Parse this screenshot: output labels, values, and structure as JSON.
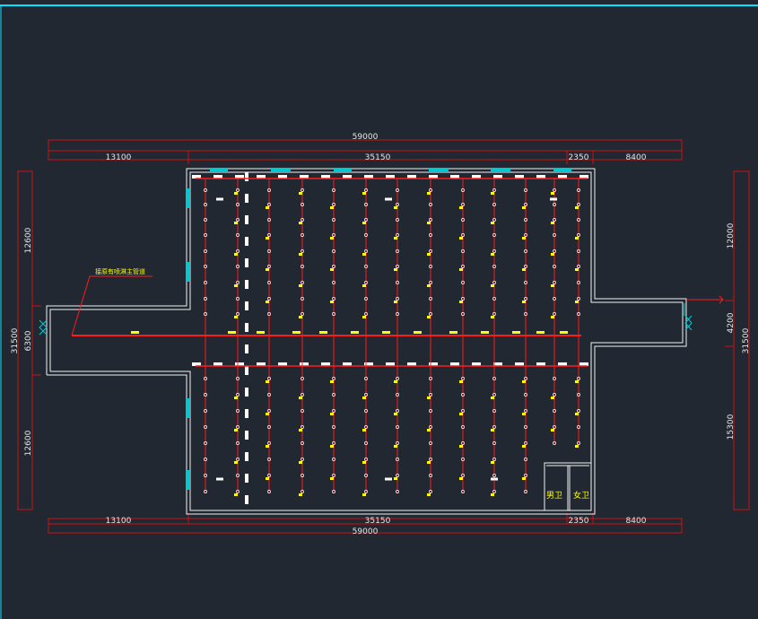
{
  "colors": {
    "background": "#222831",
    "wall": "#f2f2f2",
    "pipe": "#ff1a1a",
    "dimension_line": "#cc1111",
    "sprinkler": "#ffff00",
    "window": "#00c8d2",
    "frame": "#00e5ff"
  },
  "dimensions": {
    "top_overall": "59000",
    "top_left": "13100",
    "top_mid": "35150",
    "top_right_a": "2350",
    "top_right_b": "8400",
    "bottom_left": "13100",
    "bottom_mid": "35150",
    "bottom_right_a": "2350",
    "bottom_right_b": "8400",
    "bottom_overall": "59000",
    "left_top": "12600",
    "left_mid": "6300",
    "left_overall": "31500",
    "left_bottom": "12600",
    "right_top": "12000",
    "right_mid": "4200",
    "right_overall": "31500",
    "right_bottom": "15300"
  },
  "annotations": {
    "main_pipe_note": "接原有喷淋主管道"
  },
  "rooms": {
    "mens_toilet": "男卫",
    "womens_toilet": "女卫"
  },
  "icons": {
    "sprinkler": "sprinkler-head-icon",
    "door": "double-door-icon"
  }
}
